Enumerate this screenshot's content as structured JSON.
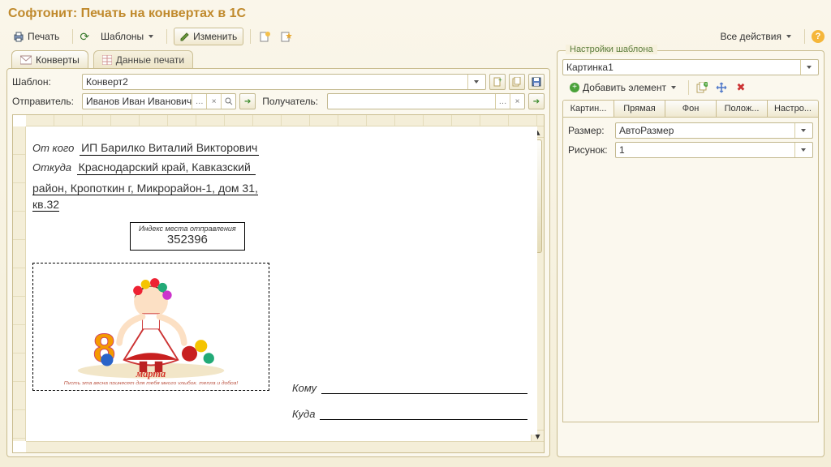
{
  "title": "Софтонит: Печать на конвертах в 1С",
  "toolbar": {
    "print": "Печать",
    "templates": "Шаблоны",
    "edit": "Изменить",
    "all_actions": "Все действия"
  },
  "tabs": {
    "envelopes": "Конверты",
    "print_data": "Данные печати"
  },
  "fields": {
    "template_label": "Шаблон:",
    "template_value": "Конверт2",
    "sender_label": "Отправитель:",
    "sender_value": "Иванов Иван Иванович",
    "recipient_label": "Получатель:",
    "recipient_value": ""
  },
  "envelope": {
    "from_whom_label": "От кого",
    "from_whom_value": "ИП Барилко Виталий Викторович",
    "from_where_label": "Откуда",
    "from_where_value": "Краснодарский край, Кавказский",
    "from_where_rest": "район, Кропоткин г, Микрорайон-1, дом 31, кв.32",
    "index_caption": "Индекс места отправления",
    "index_value": "352396",
    "to_whom_label": "Кому",
    "to_where_label": "Куда"
  },
  "settings": {
    "legend": "Настройки шаблона",
    "image_select": "Картинка1",
    "add_element": "Добавить элемент",
    "tabs": {
      "image": "Картин...",
      "line": "Прямая",
      "bg": "Фон",
      "position": "Полож...",
      "config": "Настро..."
    },
    "size_label": "Размер:",
    "size_value": "АвтоРазмер",
    "picture_label": "Рисунок:",
    "picture_value": "1"
  }
}
